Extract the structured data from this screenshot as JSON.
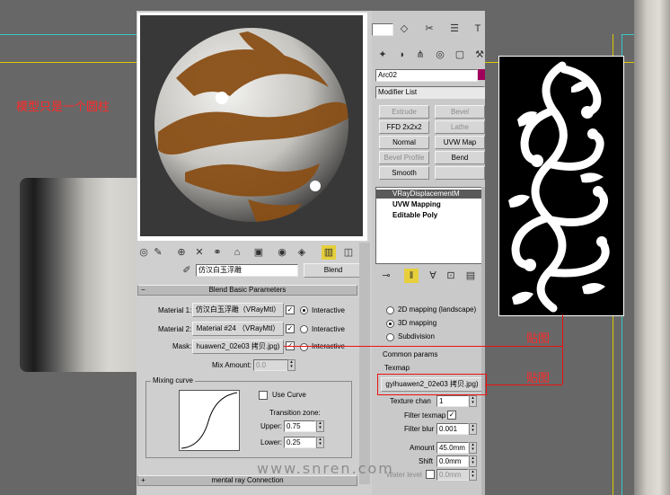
{
  "annotations": {
    "model_note": "模型只是一个圆柱",
    "label_map_1": "贴图",
    "label_map_2": "贴图",
    "watermark": "www.snren.com"
  },
  "colors": {
    "viewport_bg": "#676767",
    "viewport_line_yellow": "#d9c800",
    "viewport_line_cyan": "#36c6c6",
    "annotation_red": "#ff2a2a",
    "ui_panel": "#c8c8c8",
    "sphere_brown": "#8a4f16"
  },
  "material_editor": {
    "toolbar_icons": [
      "get-material-icon",
      "put-to-scene-icon",
      "assign-to-selection-icon",
      "delete-icon",
      "make-unique-icon",
      "put-to-library-icon",
      "material-id-icon",
      "show-map-icon",
      "show-end-result-icon",
      "go-to-parent-icon"
    ],
    "eyedropper_icon": "eyedropper-icon",
    "material_name": "仿汉白玉浮雕",
    "material_type_button": "Blend",
    "rollout_title": "Blend Basic Parameters",
    "rows": [
      {
        "label": "Material 1:",
        "value": "仿汉白玉浮雕（VRayMtl）",
        "interactive": "Interactive"
      },
      {
        "label": "Material 2:",
        "value": "Material #24 （VRayMtl）",
        "interactive": "Interactive"
      },
      {
        "label": "Mask:",
        "value": "huawen2_02e03 拷贝.jpg)",
        "interactive": "Interactive"
      }
    ],
    "mix_amount_label": "Mix Amount:",
    "mix_amount_value": "0.0",
    "mixing_curve_title": "Mixing curve",
    "use_curve_label": "Use Curve",
    "transition_zone_label": "Transition zone:",
    "upper_label": "Upper:",
    "upper_value": "0.75",
    "lower_label": "Lower:",
    "lower_value": "0.25",
    "bottom_rollout": "mental ray Connection"
  },
  "command_panel": {
    "dropdown_value": "",
    "object_name": "Arc02",
    "modifier_list": "Modifier List",
    "modifier_buttons": [
      {
        "label": "Extrude",
        "disabled": true
      },
      {
        "label": "Bevel",
        "disabled": true
      },
      {
        "label": "FFD 2x2x2",
        "disabled": false
      },
      {
        "label": "Lathe",
        "disabled": true
      },
      {
        "label": "Normal",
        "disabled": false
      },
      {
        "label": "UVW Map",
        "disabled": false
      },
      {
        "label": "Bevel Profile",
        "disabled": true
      },
      {
        "label": "Bend",
        "disabled": false
      },
      {
        "label": "Smooth",
        "disabled": false
      },
      {
        "label": "",
        "disabled": true
      }
    ],
    "stack_items": [
      "VRayDisplacementM",
      "UVW Mapping",
      "Editable Poly"
    ],
    "mapping_options": [
      "2D mapping (landscape)",
      "3D mapping",
      "Subdivision"
    ],
    "common_params_label": "Common params",
    "texmap_label": "Texmap",
    "texmap_value": "gyihuawen2_02e03 拷贝.jpg)",
    "texture_chan_label": "Texture chan",
    "texture_chan_value": "1",
    "filter_texmap_label": "Filter texmap",
    "filter_blur_label": "Filter blur",
    "filter_blur_value": "0.001",
    "amount_label": "Amount",
    "amount_value": "45.0mm",
    "shift_label": "Shift",
    "shift_value": "0.0mm",
    "water_level_label": "Water level",
    "water_level_value": "0.0mm"
  }
}
